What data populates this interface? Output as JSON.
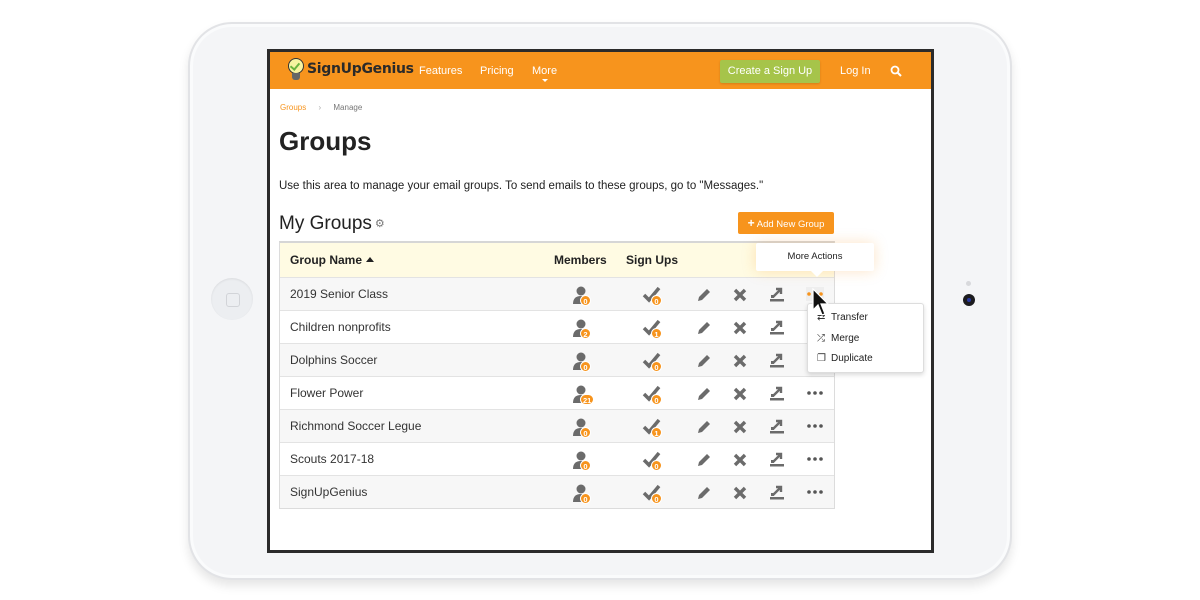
{
  "nav": {
    "logo": "SignUpGenius",
    "links": [
      "Features",
      "Pricing",
      "More"
    ],
    "create_button": "Create a Sign Up",
    "login": "Log In",
    "search_icon": "search-icon"
  },
  "breadcrumb": {
    "parent": "Groups",
    "current": "Manage"
  },
  "page": {
    "title": "Groups",
    "intro": "Use this area to manage your email groups. To send emails to these groups, go to \"Messages.\"",
    "section_title": "My Groups",
    "add_button": "Add New Group"
  },
  "table": {
    "headers": {
      "name": "Group Name",
      "members": "Members",
      "signups": "Sign Ups"
    },
    "rows": [
      {
        "name": "2019 Senior Class",
        "members": "0",
        "signups": "0"
      },
      {
        "name": "Children nonprofits",
        "members": "2",
        "signups": "1"
      },
      {
        "name": "Dolphins Soccer",
        "members": "0",
        "signups": "0"
      },
      {
        "name": "Flower Power",
        "members": "21",
        "signups": "0"
      },
      {
        "name": "Richmond Soccer Legue",
        "members": "0",
        "signups": "1"
      },
      {
        "name": "Scouts 2017-18",
        "members": "0",
        "signups": "0"
      },
      {
        "name": "SignUpGenius",
        "members": "0",
        "signups": "0"
      }
    ]
  },
  "more_actions": {
    "tooltip": "More Actions",
    "menu": [
      "Transfer",
      "Merge",
      "Duplicate"
    ]
  },
  "colors": {
    "brand": "#f7941d",
    "create": "#a6c44a",
    "header_bg": "#fffbe3"
  }
}
